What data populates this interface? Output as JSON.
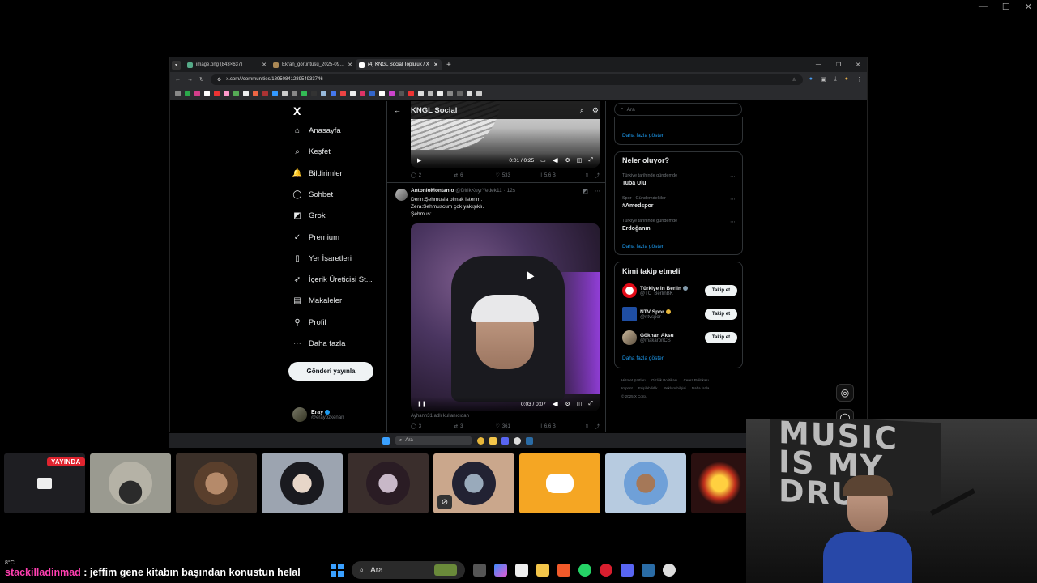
{
  "browser": {
    "tabs": [
      {
        "label": "image.png (843×637)",
        "active": false
      },
      {
        "label": "Ekran_görüntüsü_2025-09-21_1…",
        "active": false
      },
      {
        "label": "(4) KNGL Social Topluluk / X",
        "active": true
      }
    ],
    "url": "x.com/i/communities/1895084128954933746"
  },
  "nav": {
    "logo": "X",
    "items": [
      {
        "label": "Anasayfa",
        "icon": "home-icon",
        "glyph": "⌂"
      },
      {
        "label": "Keşfet",
        "icon": "search-icon",
        "glyph": "⌕"
      },
      {
        "label": "Bildirimler",
        "icon": "bell-icon",
        "glyph": "🔔"
      },
      {
        "label": "Sohbet",
        "icon": "chat-icon",
        "glyph": "◯"
      },
      {
        "label": "Grok",
        "icon": "grok-icon",
        "glyph": "◩"
      },
      {
        "label": "Premium",
        "icon": "premium-icon",
        "glyph": "✓"
      },
      {
        "label": "Yer İşaretleri",
        "icon": "bookmark-icon",
        "glyph": "▯"
      },
      {
        "label": "İçerik Üreticisi St...",
        "icon": "rocket-icon",
        "glyph": "➶"
      },
      {
        "label": "Makaleler",
        "icon": "article-icon",
        "glyph": "▤"
      },
      {
        "label": "Profil",
        "icon": "profile-icon",
        "glyph": "⚲"
      },
      {
        "label": "Daha fazla",
        "icon": "more-icon",
        "glyph": "⋯"
      }
    ],
    "post_button": "Gönderi yayınla",
    "user": {
      "name": "Eray",
      "handle": "@erayozkenan"
    }
  },
  "center": {
    "title": "KNGL Social",
    "post1": {
      "video_time": "0:01 / 0:25",
      "replies": "2",
      "reposts": "6",
      "likes": "533",
      "views": "5,6 B"
    },
    "post2": {
      "author": "AntonioMontanio",
      "handle": "@DirikKuyrYedek11",
      "time": "· 12s",
      "lines": [
        "Derin:Şehmusla olmak isterim.",
        "Zera:Şehmuscum çok yakışıklı.",
        "Şehmus:"
      ],
      "video_time": "0:03 / 0:07",
      "video_label": "Ayhann31 adlı kullanıcıdan",
      "replies": "3",
      "reposts": "3",
      "likes": "361",
      "views": "6,6 B"
    }
  },
  "right": {
    "search_placeholder": "Ara",
    "show_more": "Daha fazla göster",
    "trends_title": "Neler oluyor?",
    "trends": [
      {
        "context": "Türkiye tarihinde gündemde",
        "name": "Tuba Ulu"
      },
      {
        "context": "Spor · Gündemdekiler",
        "name": "#Amedspor"
      },
      {
        "context": "Türkiye tarihinde gündemde",
        "name": "Erdoğanın"
      }
    ],
    "wtf_title": "Kimi takip etmeli",
    "wtf": [
      {
        "name": "Türkiye in Berlin",
        "handle": "@TC_BerlinBK",
        "button": "Takip et",
        "color": "#e30a17"
      },
      {
        "name": "NTV Spor",
        "handle": "@ntvspor",
        "button": "Takip et",
        "color": "#1f4ea3"
      },
      {
        "name": "Gökhan Aksu",
        "handle": "@makaronCS",
        "button": "Takip et",
        "color": "#8a7a66"
      }
    ],
    "footer": [
      "Hizmet Şartları",
      "Gizlilik Politikası",
      "Çerez Politikası",
      "Imprint",
      "Erişilebilirlik",
      "Reklam bilgisi",
      "Daha fazla ...",
      "© 2025 X Corp."
    ]
  },
  "inner_taskbar": {
    "search": "Ara"
  },
  "stream": {
    "live_badge": "YAYINDA",
    "weather": "8°C",
    "chat_user": "stackilladinmad",
    "chat_text": " : jeffim gene kitabın başından konustun helal",
    "webcam_poster": "MUSIC\nIS MY\nDRU"
  },
  "taskbar": {
    "search": "Ara"
  },
  "colors": {
    "accent": "#1d9bf0",
    "live": "#e0242f",
    "chat_user": "#ff3fb0",
    "discord": "#f5a623"
  }
}
